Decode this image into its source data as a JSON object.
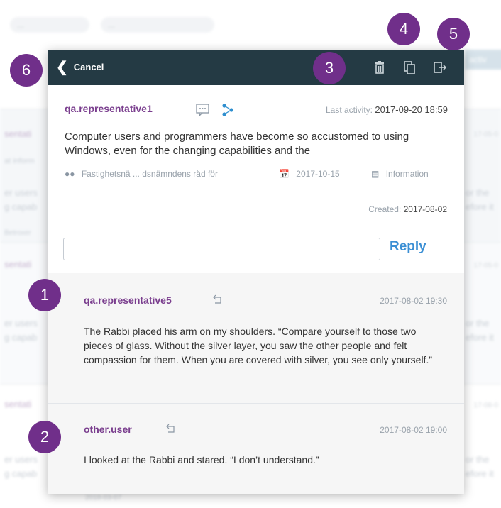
{
  "background": {
    "chips": [
      "...",
      "..."
    ],
    "rows": [
      {
        "head": "sentati",
        "sub": "at inform",
        "l1": "er users",
        "l2": "g capab",
        "r1": "or the",
        "r2": "efore it",
        "foot": "Betroxer",
        "date": "17-05-0"
      },
      {
        "head": "sentati",
        "sub": "",
        "l1": "er users",
        "l2": "g capab",
        "r1": "or the",
        "r2": "efore it",
        "foot": "",
        "date": "17-05-0"
      },
      {
        "head": "sentati",
        "sub": "",
        "l1": "er users",
        "l2": "g capab",
        "r1": "or the",
        "r2": "efore it",
        "foot": "2018-03-07",
        "date": "17-08-0"
      }
    ],
    "active_tab": "activ"
  },
  "modal": {
    "cancel_label": "Cancel",
    "toolbar_icons": [
      "trash-icon",
      "copy-icon",
      "export-icon"
    ],
    "author": "qa.representative1",
    "last_activity_label": "Last activity:",
    "last_activity_value": "2017-09-20  18:59",
    "body": "Computer users and programmers have become so accustomed to using Windows, even for the changing capabilities and the",
    "meta": {
      "group": "Fastighetsnä ... dsnämndens råd för",
      "date": "2017-10-15",
      "type": "Information"
    },
    "created_label": "Created:",
    "created_value": "2017-08-02",
    "reply_placeholder": "",
    "reply_label": "Reply",
    "comments": [
      {
        "author": "qa.representative5",
        "datetime": "2017-08-02  19:30",
        "text": "The Rabbi placed his arm on my shoulders. “Compare yourself to those two pieces of glass. Without the silver layer, you saw the other people and felt compassion for them. When you are covered with silver, you see only yourself.”"
      },
      {
        "author": "other.user",
        "datetime": "2017-08-02  19:00",
        "text": "I looked at the Rabbi and stared. “I don’t understand.”"
      }
    ]
  },
  "callouts": [
    "1",
    "2",
    "3",
    "4",
    "5",
    "6"
  ],
  "colors": {
    "topbar": "#243a44",
    "author": "#7a3e8e",
    "reply": "#3b8fd4",
    "callout": "#702f8a"
  }
}
